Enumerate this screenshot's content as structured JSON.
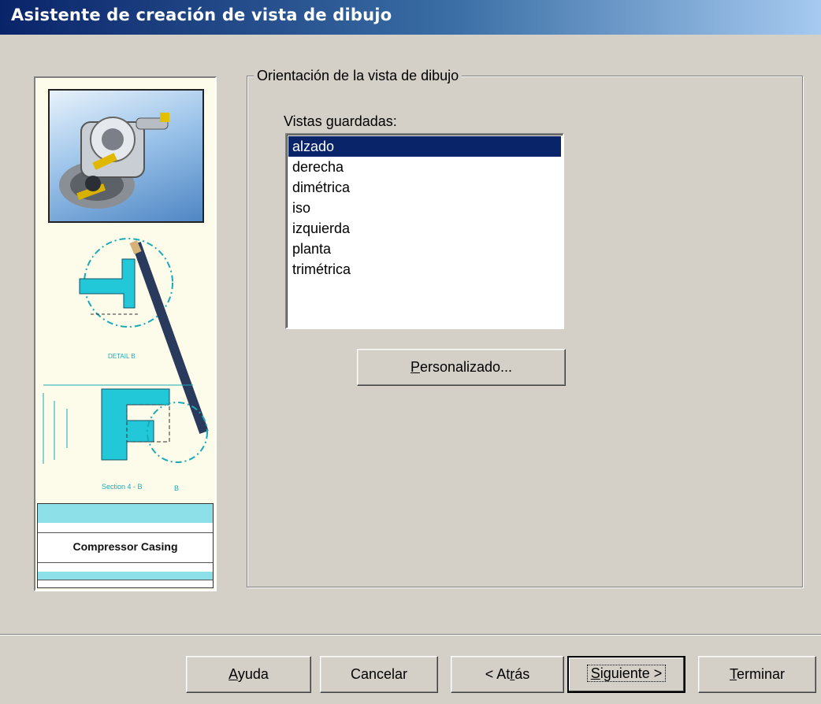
{
  "window": {
    "title": "Asistente de creación de vista de dibujo"
  },
  "illustration": {
    "caption": "Compressor Casing",
    "detail_label": "DETAIL B",
    "section_label": "Section 4 - B",
    "section_letter": "B"
  },
  "group": {
    "legend": "Orientación de la vista de dibujo"
  },
  "saved_views": {
    "label": "Vistas guardadas:",
    "items": [
      "alzado",
      "derecha",
      "dimétrica",
      "iso",
      "izquierda",
      "planta",
      "trimétrica"
    ],
    "selected": "alzado"
  },
  "buttons": {
    "custom": {
      "pre": "",
      "key": "P",
      "post": "ersonalizado..."
    },
    "help": {
      "pre": "",
      "key": "A",
      "post": "yuda"
    },
    "cancel": {
      "label": "Cancelar"
    },
    "back": {
      "pre": "< At",
      "key": "r",
      "post": "ás"
    },
    "next": {
      "pre": "",
      "key": "S",
      "post": "iguiente >"
    },
    "finish": {
      "pre": "",
      "key": "T",
      "post": "erminar"
    }
  },
  "colors": {
    "selection": "#0a246a",
    "face": "#d4d0c8",
    "title_start": "#0a246a",
    "title_end": "#a6caf0",
    "hatch": "#22c8d8"
  }
}
